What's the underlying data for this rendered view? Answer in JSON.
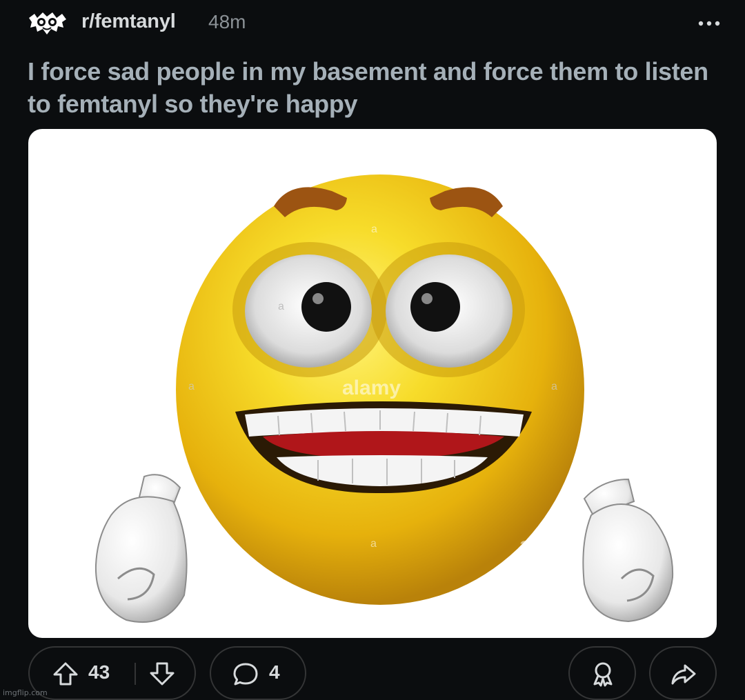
{
  "post": {
    "subreddit": "r/femtanyl",
    "time_ago": "48m",
    "title": "I force sad people in my basement and force them to listen to femtanyl so they're happy",
    "image": {
      "watermarks": [
        "alamy",
        "a",
        "a",
        "a",
        "a",
        "a",
        "ala"
      ]
    }
  },
  "actions": {
    "vote_count": "43",
    "comment_count": "4"
  },
  "icons": {
    "avatar": "subreddit-avatar",
    "more": "ellipsis-icon",
    "upvote": "arrow-up-icon",
    "downvote": "arrow-down-icon",
    "comment": "speech-bubble-icon",
    "award": "award-ribbon-icon",
    "share": "share-arrow-icon"
  },
  "footer": {
    "watermark": "imgflip.com"
  },
  "colors": {
    "background": "#0b0d0f",
    "title": "#a5b0b8",
    "pill_border": "#343536",
    "emoji_yellow": "#f2cc12"
  }
}
